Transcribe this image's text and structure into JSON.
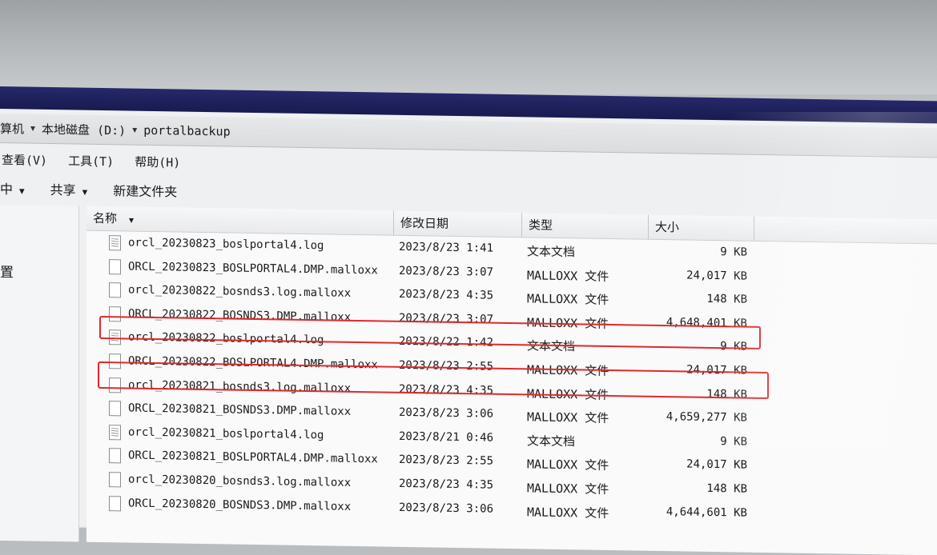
{
  "address": {
    "segments": [
      "算机",
      "本地磁盘 (D:)",
      "portalbackup"
    ]
  },
  "menu": [
    "查看(V)",
    "工具(T)",
    "帮助(H)"
  ],
  "toolbar": {
    "include": "中",
    "share": "共享",
    "new_folder": "新建文件夹"
  },
  "left_pane": {
    "label": "置"
  },
  "columns": {
    "name": "名称",
    "date": "修改日期",
    "type": "类型",
    "size": "大小"
  },
  "files": [
    {
      "name": "orcl_20230823_boslportal4.log",
      "date": "2023/8/23 1:41",
      "type": "文本文档",
      "size": "9 KB",
      "icon": "text-file-icon"
    },
    {
      "name": "ORCL_20230823_BOSLPORTAL4.DMP.malloxx",
      "date": "2023/8/23 3:07",
      "type": "MALLOXX 文件",
      "size": "24,017 KB",
      "icon": "file-icon"
    },
    {
      "name": "orcl_20230822_bosnds3.log.malloxx",
      "date": "2023/8/23 4:35",
      "type": "MALLOXX 文件",
      "size": "148 KB",
      "icon": "file-icon"
    },
    {
      "name": "ORCL_20230822_BOSNDS3.DMP.malloxx",
      "date": "2023/8/23 3:07",
      "type": "MALLOXX 文件",
      "size": "4,648,401 KB",
      "icon": "file-icon"
    },
    {
      "name": "orcl_20230822_boslportal4.log",
      "date": "2023/8/22 1:42",
      "type": "文本文档",
      "size": "9 KB",
      "icon": "text-file-icon"
    },
    {
      "name": "ORCL_20230822_BOSLPORTAL4.DMP.malloxx",
      "date": "2023/8/23 2:55",
      "type": "MALLOXX 文件",
      "size": "24,017 KB",
      "icon": "file-icon"
    },
    {
      "name": "orcl_20230821_bosnds3.log.malloxx",
      "date": "2023/8/23 4:35",
      "type": "MALLOXX 文件",
      "size": "148 KB",
      "icon": "file-icon"
    },
    {
      "name": "ORCL_20230821_BOSNDS3.DMP.malloxx",
      "date": "2023/8/23 3:06",
      "type": "MALLOXX 文件",
      "size": "4,659,277 KB",
      "icon": "file-icon"
    },
    {
      "name": "orcl_20230821_boslportal4.log",
      "date": "2023/8/21 0:46",
      "type": "文本文档",
      "size": "9 KB",
      "icon": "text-file-icon"
    },
    {
      "name": "ORCL_20230821_BOSLPORTAL4.DMP.malloxx",
      "date": "2023/8/23 2:55",
      "type": "MALLOXX 文件",
      "size": "24,017 KB",
      "icon": "file-icon"
    },
    {
      "name": "orcl_20230820_bosnds3.log.malloxx",
      "date": "2023/8/23 4:35",
      "type": "MALLOXX 文件",
      "size": "148 KB",
      "icon": "file-icon"
    },
    {
      "name": "ORCL_20230820_BOSNDS3.DMP.malloxx",
      "date": "2023/8/23 3:06",
      "type": "MALLOXX 文件",
      "size": "4,644,601 KB",
      "icon": "file-icon"
    }
  ],
  "highlighted_rows": [
    3,
    5
  ],
  "colors": {
    "highlight": "#e0292b",
    "title_bar": "#1c1e56"
  }
}
